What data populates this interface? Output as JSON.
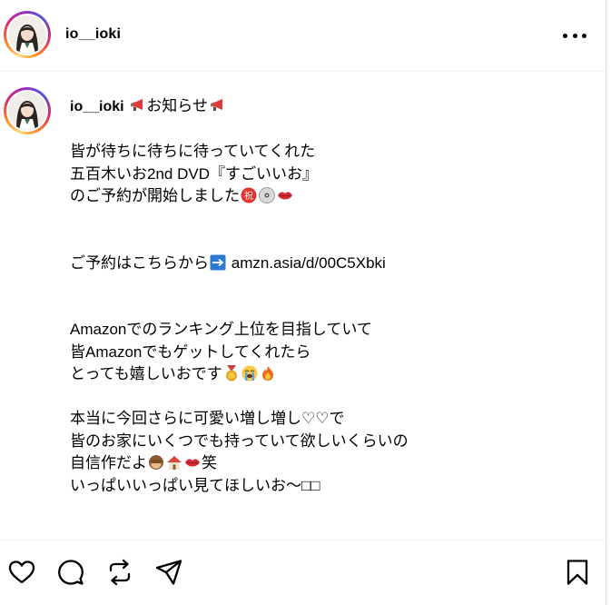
{
  "post": {
    "username": "io__ioki"
  },
  "caption": {
    "username": "io__ioki",
    "title": "お知らせ",
    "line1": "皆が待ちに待ちに待っていてくれた",
    "line2": "五百木いお2nd DVD『すごいいお』",
    "line3": "のご予約が開始しました",
    "line4": "ご予約はこちらから",
    "link": "amzn.asia/d/00C5Xbki",
    "line5": "Amazonでのランキング上位を目指していて",
    "line6": "皆Amazonでもゲットしてくれたら",
    "line7": "とっても嬉しいおです",
    "line8": "本当に今回さらに可愛い増し増し♡♡で",
    "line9": "皆のお家にいくつでも持っていて欲しいくらいの",
    "line10a": "自信作だよ",
    "line10b": "笑",
    "line11": "いっぱいいっぱい見てほしいお〜",
    "line11_tail": "□□"
  },
  "icons": {
    "megaphone": "megaphone-icon",
    "celebrate": "congratulations-kanji-icon",
    "dvd": "dvd-icon",
    "lips": "lips-icon",
    "arrow": "right-arrow-icon",
    "medal": "medal-icon",
    "crying": "crying-face-icon",
    "fire": "fire-icon",
    "monkey": "see-no-evil-monkey-icon",
    "house": "house-icon"
  }
}
